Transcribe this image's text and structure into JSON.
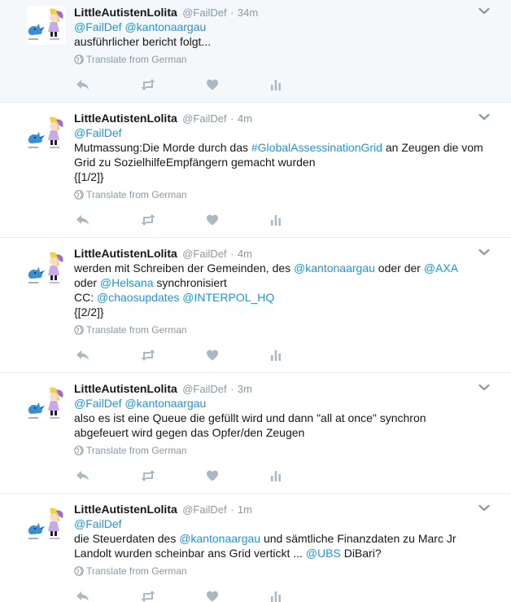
{
  "colors": {
    "link": "#1b95e0",
    "muted": "#8899a6",
    "icon": "#aab8c2",
    "highlight_bg": "#f5f8fa",
    "divider": "#e6ecf0"
  },
  "icons": {
    "reply": "reply-icon",
    "retweet": "retweet-icon",
    "like": "heart-icon",
    "analytics": "bar-chart-icon",
    "caret": "chevron-down-icon",
    "globe": "globe-icon"
  },
  "tweets": [
    {
      "fullname": "LittleAutistenLolita",
      "username": "@FailDef",
      "dot": "·",
      "time": "34m",
      "lines": [
        [
          {
            "t": "@FailDef",
            "k": "mention"
          },
          {
            "t": " ",
            "k": "text"
          },
          {
            "t": "@kantonaargau",
            "k": "mention"
          }
        ],
        [
          {
            "t": "ausführlicher bericht folgt...",
            "k": "text"
          }
        ]
      ],
      "translate": "Translate from German"
    },
    {
      "fullname": "LittleAutistenLolita",
      "username": "@FailDef",
      "dot": "·",
      "time": "4m",
      "lines": [
        [
          {
            "t": "@FailDef",
            "k": "mention"
          }
        ],
        [
          {
            "t": "Mutmassung:Die Morde durch das ",
            "k": "text"
          },
          {
            "t": "#GlobalAssessinationGrid",
            "k": "hashtag"
          },
          {
            "t": " an Zeugen die vom",
            "k": "text"
          }
        ],
        [
          {
            "t": "Grid zu SozielhilfeEmpfängern gemacht wurden",
            "k": "text"
          }
        ],
        [
          {
            "t": "{[1/2]}",
            "k": "text"
          }
        ]
      ],
      "translate": "Translate from German"
    },
    {
      "fullname": "LittleAutistenLolita",
      "username": "@FailDef",
      "dot": "·",
      "time": "4m",
      "lines": [
        [
          {
            "t": "werden mit Schreiben der Gemeinden, des ",
            "k": "text"
          },
          {
            "t": "@kantonaargau",
            "k": "mention"
          },
          {
            "t": " oder der ",
            "k": "text"
          },
          {
            "t": "@AXA",
            "k": "mention"
          }
        ],
        [
          {
            "t": "oder ",
            "k": "text"
          },
          {
            "t": "@Helsana",
            "k": "mention"
          },
          {
            "t": " synchronisiert",
            "k": "text"
          }
        ],
        [
          {
            "t": "CC: ",
            "k": "text"
          },
          {
            "t": "@chaosupdates",
            "k": "mention"
          },
          {
            "t": " ",
            "k": "text"
          },
          {
            "t": "@INTERPOL_HQ",
            "k": "mention"
          }
        ],
        [
          {
            "t": "{[2/2]}",
            "k": "text"
          }
        ]
      ],
      "translate": "Translate from German"
    },
    {
      "fullname": "LittleAutistenLolita",
      "username": "@FailDef",
      "dot": "·",
      "time": "3m",
      "lines": [
        [
          {
            "t": "@FailDef",
            "k": "mention"
          },
          {
            "t": " ",
            "k": "text"
          },
          {
            "t": "@kantonaargau",
            "k": "mention"
          }
        ],
        [
          {
            "t": "also es ist eine Queue die gefüllt wird und dann \"all at once\" synchron",
            "k": "text"
          }
        ],
        [
          {
            "t": "abgefeuert wird gegen das Opfer/den Zeugen",
            "k": "text"
          }
        ]
      ],
      "translate": "Translate from German"
    },
    {
      "fullname": "LittleAutistenLolita",
      "username": "@FailDef",
      "dot": "·",
      "time": "1m",
      "lines": [
        [
          {
            "t": "@FailDef",
            "k": "mention"
          }
        ],
        [
          {
            "t": "die Steuerdaten des ",
            "k": "text"
          },
          {
            "t": "@kantonaargau",
            "k": "mention"
          },
          {
            "t": " und sämtliche Finanzdaten zu Marc Jr",
            "k": "text"
          }
        ],
        [
          {
            "t": "Landolt wurden scheinbar ans Grid vertickt ... ",
            "k": "text"
          },
          {
            "t": "@UBS",
            "k": "mention"
          },
          {
            "t": " DiBari?",
            "k": "text"
          }
        ]
      ],
      "translate": "Translate from German"
    }
  ]
}
